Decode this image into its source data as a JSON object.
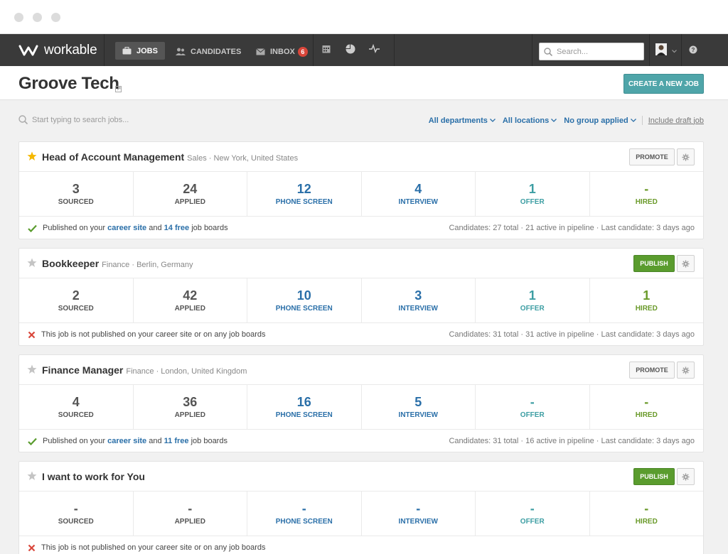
{
  "nav": {
    "logo_text": "workable",
    "jobs": "JOBS",
    "candidates": "CANDIDATES",
    "inbox": "INBOX",
    "inbox_count": "6",
    "search_placeholder": "Search..."
  },
  "header": {
    "company": "Groove Tech",
    "create_button": "CREATE A NEW JOB"
  },
  "filters": {
    "search_placeholder": "Start typing to search jobs...",
    "departments": "All departments",
    "locations": "All locations",
    "group": "No group applied",
    "include_draft": "Include draft job"
  },
  "stage_labels": [
    "SOURCED",
    "APPLIED",
    "PHONE SCREEN",
    "INTERVIEW",
    "OFFER",
    "HIRED"
  ],
  "jobs": [
    {
      "title": "Head of Account Management",
      "meta": "Sales · New York, United States",
      "starred": true,
      "action": "PROMOTE",
      "counts": [
        "3",
        "24",
        "12",
        "4",
        "1",
        "-"
      ],
      "published": true,
      "foot_pre": "Published on your",
      "foot_link1": "career site",
      "foot_mid": "and",
      "foot_link2": "14 free",
      "foot_post": "job boards",
      "summary": "Candidates: 27 total · 21 active in pipeline · Last candidate: 3 days ago"
    },
    {
      "title": "Bookkeeper",
      "meta": "Finance · Berlin, Germany",
      "starred": false,
      "action": "PUBLISH",
      "counts": [
        "2",
        "42",
        "10",
        "3",
        "1",
        "1"
      ],
      "published": false,
      "foot_text": "This job is not published on your career site or on any job boards",
      "summary": "Candidates: 31 total · 31 active in pipeline · Last candidate: 3 days ago"
    },
    {
      "title": "Finance Manager",
      "meta": "Finance · London, United Kingdom",
      "starred": false,
      "action": "PROMOTE",
      "counts": [
        "4",
        "36",
        "16",
        "5",
        "-",
        "-"
      ],
      "published": true,
      "foot_pre": "Published on your",
      "foot_link1": "career site",
      "foot_mid": "and",
      "foot_link2": "11 free",
      "foot_post": "job boards",
      "summary": "Candidates: 31 total · 16 active in pipeline · Last candidate: 3 days ago"
    },
    {
      "title": "I want to work for You",
      "meta": "",
      "starred": false,
      "action": "PUBLISH",
      "counts": [
        "-",
        "-",
        "-",
        "-",
        "-",
        "-"
      ],
      "published": false,
      "foot_text": "This job is not published on your career site or on any job boards",
      "summary": ""
    }
  ],
  "colors": {
    "navbar": "#3a3a3a",
    "accent_teal": "#4fa5a9",
    "publish_green": "#5a9c2e",
    "link_blue": "#2a6fa8"
  }
}
